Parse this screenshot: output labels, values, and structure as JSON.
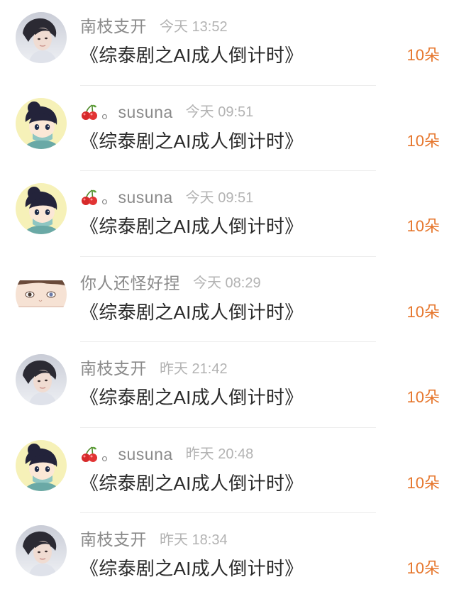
{
  "accent_color": "#e6762c",
  "comments": [
    {
      "avatar": "portrait-avatar",
      "username": "南枝支开",
      "has_cherry": false,
      "time": "今天 13:52",
      "text": "《综泰剧之AI成人倒计时》",
      "flowers": "10朵"
    },
    {
      "avatar": "cartoon-avatar",
      "username": "。susuna",
      "has_cherry": true,
      "time": "今天 09:51",
      "text": "《综泰剧之AI成人倒计时》",
      "flowers": "10朵"
    },
    {
      "avatar": "cartoon-avatar",
      "username": "。susuna",
      "has_cherry": true,
      "time": "今天 09:51",
      "text": "《综泰剧之AI成人倒计时》",
      "flowers": "10朵"
    },
    {
      "avatar": "eyes-avatar",
      "username": "你人还怪好捏",
      "has_cherry": false,
      "time": "今天 08:29",
      "text": "《综泰剧之AI成人倒计时》",
      "flowers": "10朵"
    },
    {
      "avatar": "portrait-avatar",
      "username": "南枝支开",
      "has_cherry": false,
      "time": "昨天 21:42",
      "text": "《综泰剧之AI成人倒计时》",
      "flowers": "10朵"
    },
    {
      "avatar": "cartoon-avatar",
      "username": "。susuna",
      "has_cherry": true,
      "time": "昨天 20:48",
      "text": "《综泰剧之AI成人倒计时》",
      "flowers": "10朵"
    },
    {
      "avatar": "portrait-avatar",
      "username": "南枝支开",
      "has_cherry": false,
      "time": "昨天 18:34",
      "text": "《综泰剧之AI成人倒计时》",
      "flowers": "10朵"
    }
  ]
}
